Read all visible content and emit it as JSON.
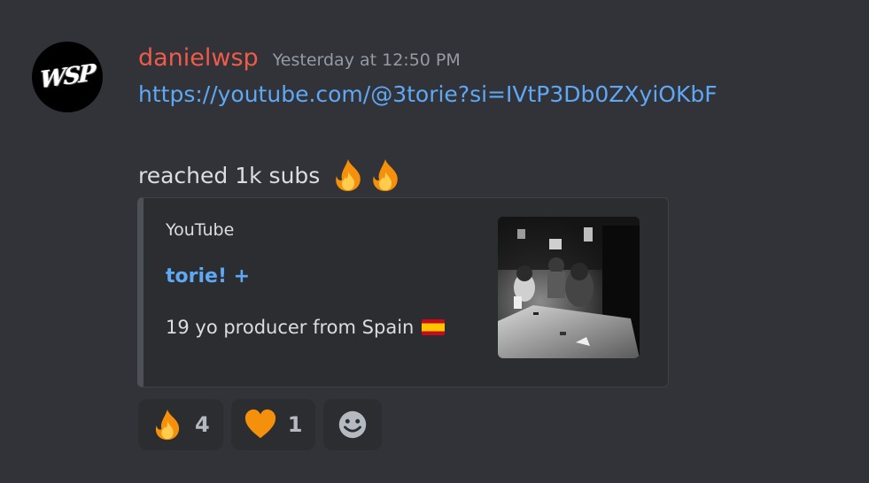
{
  "message": {
    "avatar_text": "WSP",
    "username": "danielwsp",
    "timestamp": "Yesterday at 12:50 PM",
    "link": "https://youtube.com/@3torie?si=IVtP3Db0ZXyiOKbF",
    "text": "reached 1k subs",
    "emojis": [
      "fire-icon",
      "fire-icon"
    ]
  },
  "embed": {
    "provider": "YouTube",
    "title": "torie! +",
    "description": "19 yo producer from Spain",
    "flag": "spain-flag-icon"
  },
  "reactions": [
    {
      "icon": "fire-icon",
      "count": "4"
    },
    {
      "icon": "orange-heart-icon",
      "count": "1"
    },
    {
      "icon": "add-reaction-icon"
    }
  ],
  "colors": {
    "background": "#313338",
    "username": "#ef5b4b",
    "link": "#5ea8f5",
    "embed_bg": "#2b2d31",
    "embed_border": "#4e5058",
    "reaction_bg": "#2b2d31",
    "heart": "#f4900c"
  }
}
